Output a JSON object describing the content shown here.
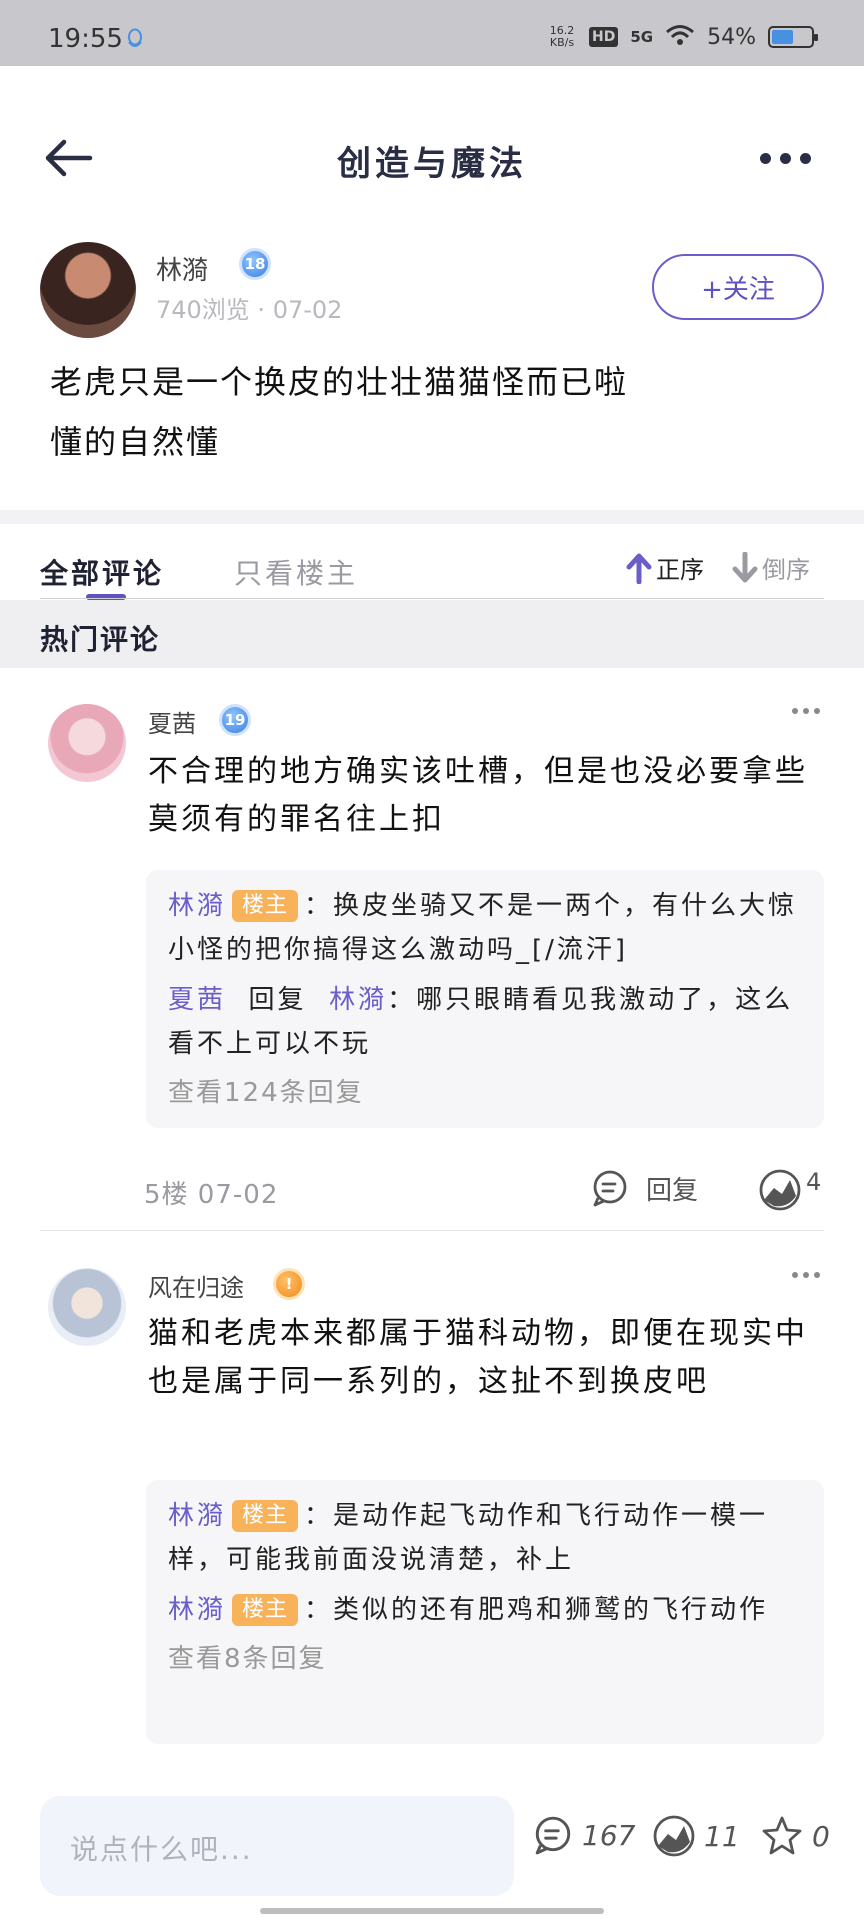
{
  "status": {
    "time": "19:55",
    "speed": "16.2\nKB/s",
    "hd": "HD",
    "network": "5G",
    "battery": "54%",
    "battery_level": 0.54
  },
  "header": {
    "title": "创造与魔法"
  },
  "post": {
    "author": "林漪",
    "author_level": "18",
    "meta": "740浏览 · 07-02",
    "follow_label": "+关注",
    "text_line1": "老虎只是一个换皮的壮壮猫猫怪而已啦",
    "text_line2": "懂的自然懂"
  },
  "tabs": {
    "all": "全部评论",
    "owner_only": "只看楼主",
    "sort_asc": "正序",
    "sort_desc": "倒序"
  },
  "hot_label": "热门评论",
  "comments": [
    {
      "name": "夏茜",
      "level": "19",
      "text": "不合理的地方确实该吐槽，但是也没必要拿些莫须有的罪名往上扣",
      "replies": [
        {
          "name": "林漪",
          "tag": "楼主",
          "sep": "：",
          "text": "换皮坐骑又不是一两个，有什么大惊小怪的把你搞得这么激动吗_[/流汗]"
        },
        {
          "name": "夏茜",
          "reply_word": "回复",
          "target": "林漪",
          "sep": "：",
          "text": "哪只眼睛看见我激动了，这么看不上可以不玩"
        }
      ],
      "view_more": "查看124条回复",
      "floor": "5楼  07-02",
      "reply_label": "回复",
      "likes": "4"
    },
    {
      "name": "风在归途",
      "level": "!",
      "text": "猫和老虎本来都属于猫科动物，即便在现实中也是属于同一系列的，这扯不到换皮吧",
      "replies": [
        {
          "name": "林漪",
          "tag": "楼主",
          "sep": "：",
          "text": "是动作起飞动作和飞行动作一模一样，可能我前面没说清楚，补上"
        },
        {
          "name": "林漪",
          "tag": "楼主",
          "sep": "：",
          "text": "类似的还有肥鸡和狮鹫的飞行动作"
        }
      ],
      "view_more": "查看8条回复"
    }
  ],
  "bottom": {
    "placeholder": "说点什么吧...",
    "comments": "167",
    "likes": "11",
    "stars": "0"
  },
  "colors": {
    "accent": "#5d52c2",
    "owner_tag": "#f7b25a",
    "reply_bg": "#f6f6f8"
  }
}
